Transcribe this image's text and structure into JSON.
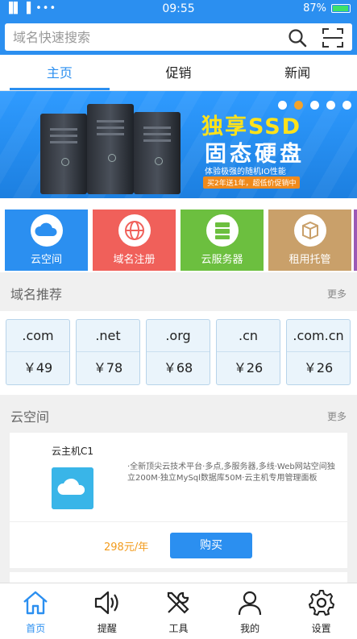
{
  "status_bar": {
    "signal": "▐▌▐ •••",
    "time": "09:55",
    "battery": "87%"
  },
  "search": {
    "placeholder": "域名快速搜索"
  },
  "tabs": [
    {
      "label": "主页",
      "active": true
    },
    {
      "label": "促销",
      "active": false
    },
    {
      "label": "新闻",
      "active": false
    }
  ],
  "banner": {
    "title": "独享SSD",
    "subtitle": "固态硬盘",
    "desc": "体验极强的随机IO性能",
    "promo": "买2年送1年，超低价促销中",
    "dots": 5,
    "active_dot": 1
  },
  "categories": [
    {
      "label": "云空间",
      "color": "#2b8ff0",
      "icon": "cloud-icon"
    },
    {
      "label": "域名注册",
      "color": "#f0605a",
      "icon": "globe-icon"
    },
    {
      "label": "云服务器",
      "color": "#6cbf3f",
      "icon": "server-icon"
    },
    {
      "label": "租用托管",
      "color": "#c9a06a",
      "icon": "box-icon"
    }
  ],
  "domain_section": {
    "title": "域名推荐",
    "more": "更多"
  },
  "domains": [
    {
      "ext": ".com",
      "price": "￥49"
    },
    {
      "ext": ".net",
      "price": "￥78"
    },
    {
      "ext": ".org",
      "price": "￥68"
    },
    {
      "ext": ".cn",
      "price": "￥26"
    },
    {
      "ext": ".com.cn",
      "price": "￥26"
    }
  ],
  "cloud_section": {
    "title": "云空间",
    "more": "更多"
  },
  "product": {
    "name": "云主机C1",
    "desc": "·全新顶尖云技术平台·多点,多服务器,多线·Web网站空间独立200M·独立MySql数据库50M·云主机专用管理面板",
    "price": "298元/年",
    "buy_label": "购买"
  },
  "bottom_nav": [
    {
      "label": "首页",
      "icon": "home-icon",
      "active": true
    },
    {
      "label": "提醒",
      "icon": "speaker-icon",
      "active": false
    },
    {
      "label": "工具",
      "icon": "tools-icon",
      "active": false
    },
    {
      "label": "我的",
      "icon": "user-icon",
      "active": false
    },
    {
      "label": "设置",
      "icon": "gear-icon",
      "active": false
    }
  ],
  "colors": {
    "accent": "#2b8ff0",
    "price": "#f29b1c"
  }
}
